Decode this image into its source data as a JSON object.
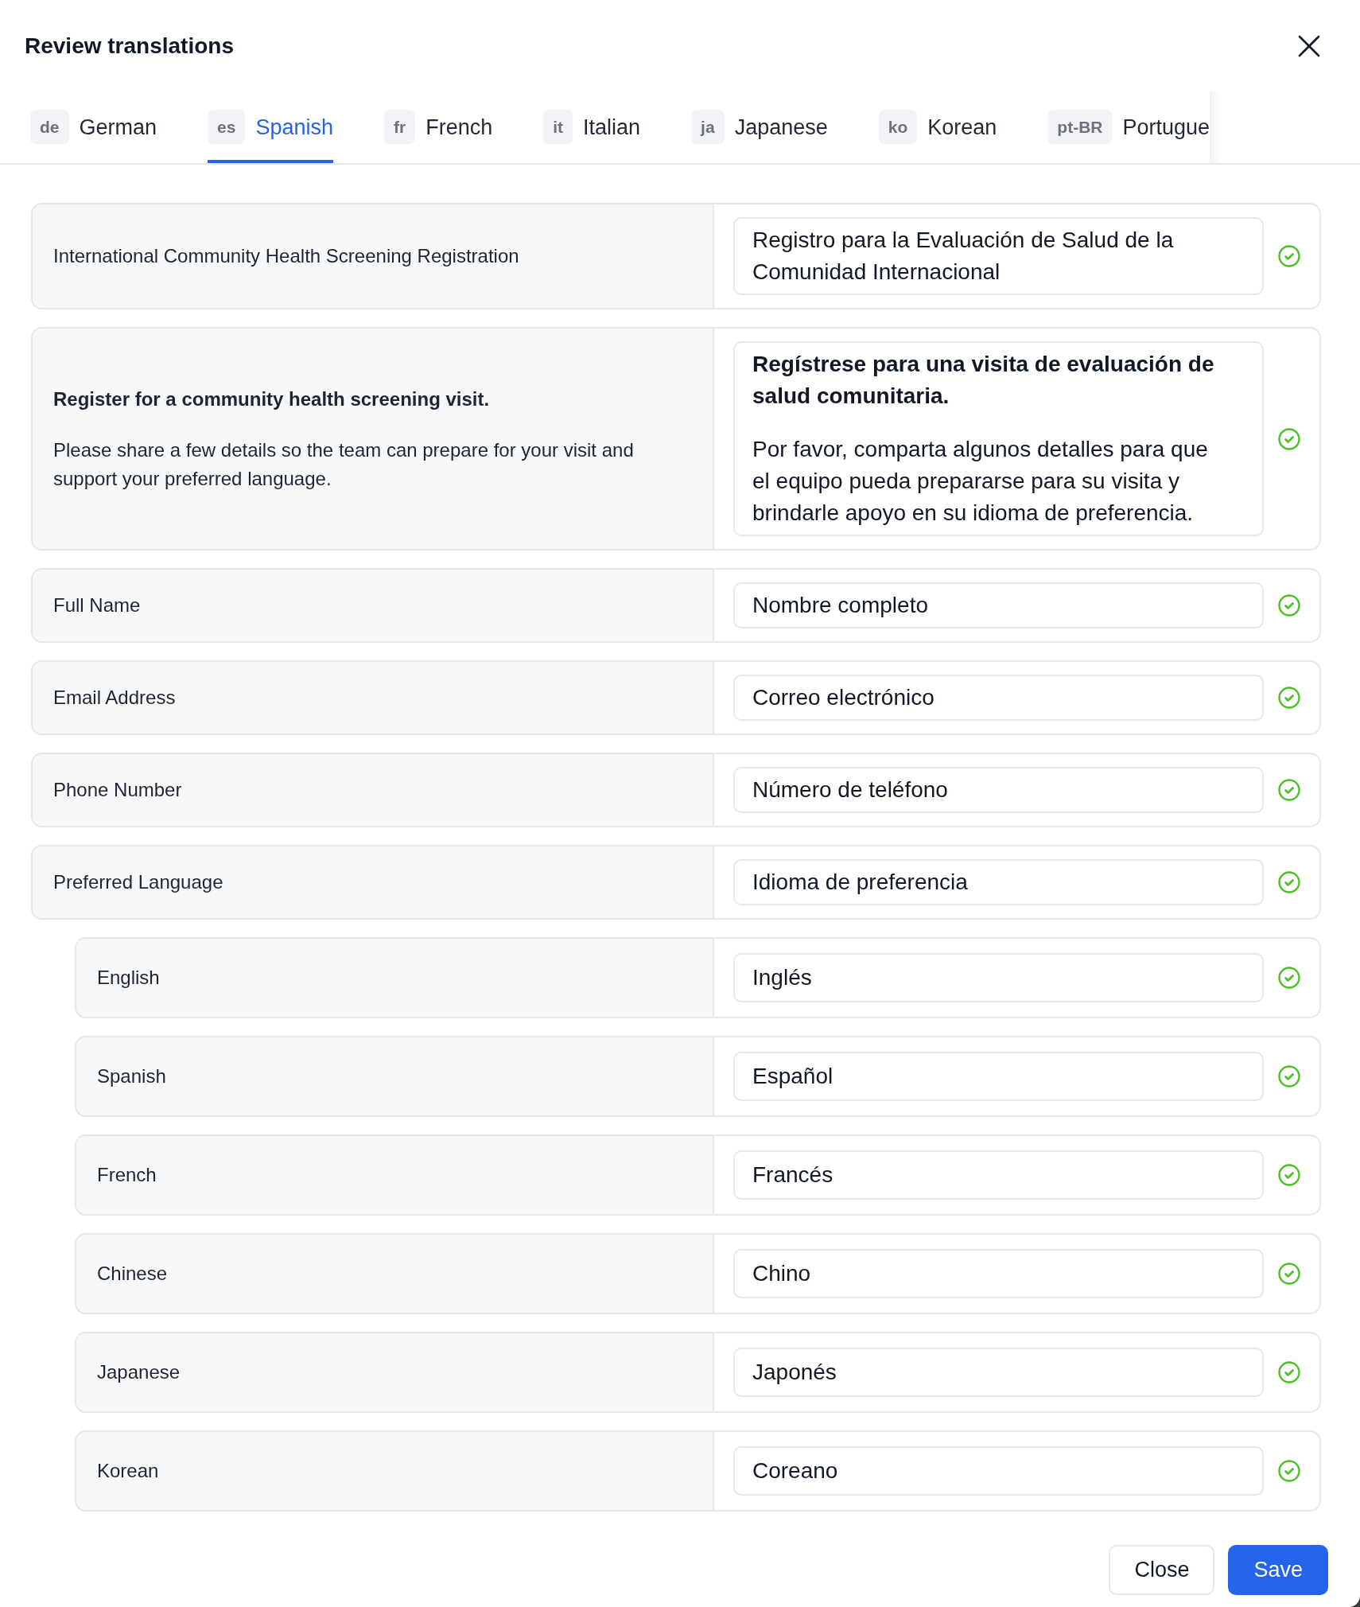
{
  "dialog": {
    "title": "Review translations"
  },
  "tabs": [
    {
      "code": "de",
      "label": "German",
      "selected": false
    },
    {
      "code": "es",
      "label": "Spanish",
      "selected": true
    },
    {
      "code": "fr",
      "label": "French",
      "selected": false
    },
    {
      "code": "it",
      "label": "Italian",
      "selected": false
    },
    {
      "code": "ja",
      "label": "Japanese",
      "selected": false
    },
    {
      "code": "ko",
      "label": "Korean",
      "selected": false
    },
    {
      "code": "pt-BR",
      "label": "Portugue",
      "selected": false
    }
  ],
  "rows": [
    {
      "kind": "field",
      "source": "International Community Health Screening Registration",
      "translation": "Registro para la Evaluación de Salud de la Comunidad Internacional",
      "approved": true
    },
    {
      "kind": "message",
      "source": {
        "heading": "Register for a community health screening visit.",
        "body": "Please share a few details so the team can prepare for your visit and support your preferred language."
      },
      "translation": {
        "heading": "Regístrese para una visita de evaluación de salud comunitaria.",
        "body": "Por favor, comparta algunos detalles para que el equipo pueda prepararse para su visita y brindarle apoyo en su idioma de preferencia."
      },
      "approved": true
    },
    {
      "kind": "field",
      "source": "Full Name",
      "translation": "Nombre completo",
      "approved": true
    },
    {
      "kind": "field",
      "source": "Email Address",
      "translation": "Correo electrónico",
      "approved": true
    },
    {
      "kind": "field",
      "source": "Phone Number",
      "translation": "Número de teléfono",
      "approved": true
    },
    {
      "kind": "field",
      "source": "Preferred Language",
      "translation": "Idioma de preferencia",
      "approved": true,
      "children": [
        {
          "kind": "field",
          "source": "English",
          "translation": "Inglés",
          "approved": true
        },
        {
          "kind": "field",
          "source": "Spanish",
          "translation": "Español",
          "approved": true
        },
        {
          "kind": "field",
          "source": "French",
          "translation": "Francés",
          "approved": true
        },
        {
          "kind": "field",
          "source": "Chinese",
          "translation": "Chino",
          "approved": true
        },
        {
          "kind": "field",
          "source": "Japanese",
          "translation": "Japonés",
          "approved": true
        },
        {
          "kind": "field",
          "source": "Korean",
          "translation": "Coreano",
          "approved": true
        }
      ]
    }
  ],
  "buttons": [
    {
      "kind": "secondary",
      "label": "Close"
    },
    {
      "kind": "primary",
      "label": "Save"
    }
  ]
}
